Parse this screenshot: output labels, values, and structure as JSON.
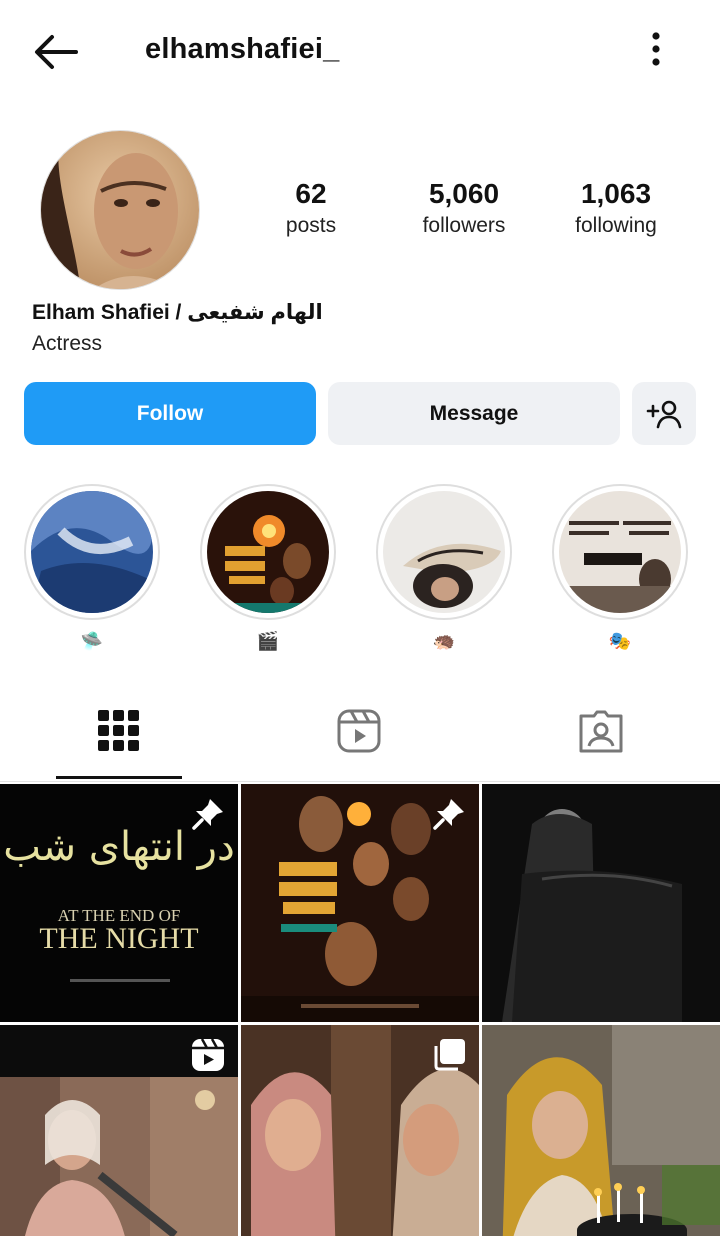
{
  "header": {
    "username": "elhamshafiei_",
    "back_icon": "arrow-left-icon",
    "more_icon": "more-vertical-icon"
  },
  "profile": {
    "full_name": "Elham Shafiei / الهام شفیعی",
    "bio": "Actress",
    "stats": [
      {
        "value": "62",
        "label": "posts"
      },
      {
        "value": "5,060",
        "label": "followers"
      },
      {
        "value": "1,063",
        "label": "following"
      }
    ]
  },
  "actions": {
    "follow": "Follow",
    "message": "Message",
    "add_user_icon": "person-add-icon"
  },
  "highlights": [
    {
      "label": "🛸"
    },
    {
      "label": "🎬"
    },
    {
      "label": "🦔"
    },
    {
      "label": "🎭"
    }
  ],
  "tabs": [
    "grid-icon",
    "reels-icon",
    "tagged-icon"
  ],
  "posts": [
    {
      "poster_fa": "در انتهای شب",
      "poster_line1": "AT THE END OF",
      "poster_line2": "THE NIGHT",
      "badge": "pin-icon"
    },
    {
      "badge": "pin-icon"
    },
    {
      "badge": ""
    },
    {
      "badge": "reel-icon"
    },
    {
      "badge": "carousel-icon"
    },
    {
      "badge": ""
    }
  ],
  "colors": {
    "primary": "#1f9bf6",
    "secondary_button": "#eff1f4",
    "text": "#111111"
  }
}
